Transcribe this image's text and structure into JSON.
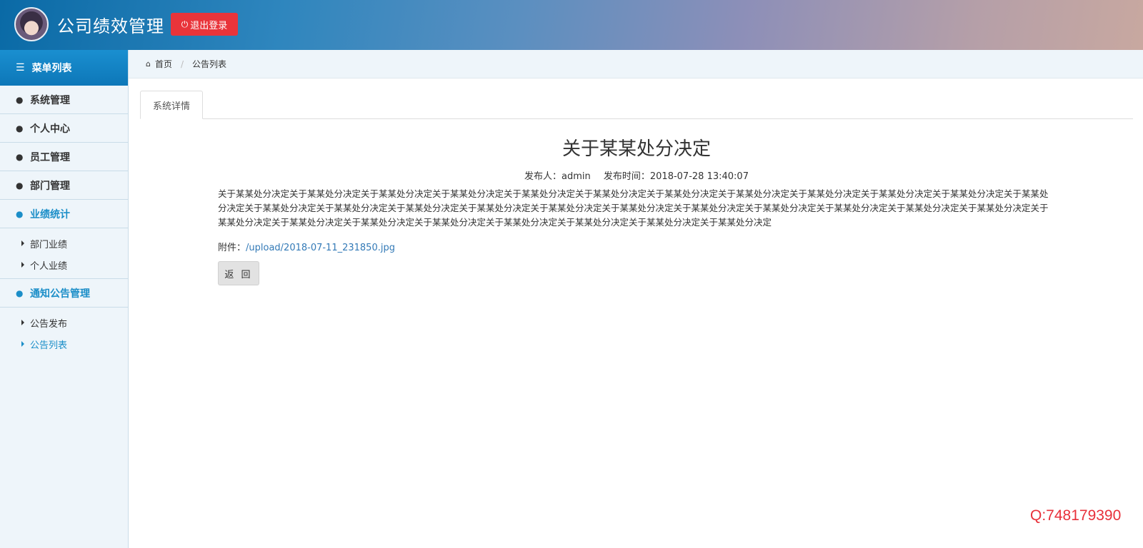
{
  "header": {
    "title": "公司绩效管理",
    "logout_label": "退出登录"
  },
  "sidebar": {
    "header_label": "菜单列表",
    "items": [
      {
        "label": "系统管理"
      },
      {
        "label": "个人中心"
      },
      {
        "label": "员工管理"
      },
      {
        "label": "部门管理"
      },
      {
        "label": "业绩统计",
        "active": true,
        "children": [
          "部门业绩",
          "个人业绩"
        ]
      },
      {
        "label": "通知公告管理",
        "active": true,
        "children": [
          "公告发布",
          "公告列表"
        ]
      }
    ],
    "active_child": "公告列表"
  },
  "breadcrumb": {
    "home": "首页",
    "current": "公告列表"
  },
  "tabs": [
    {
      "label": "系统详情"
    }
  ],
  "notice": {
    "title": "关于某某处分决定",
    "publisher_label": "发布人：admin",
    "time_label": "发布时间：2018-07-28 13:40:07",
    "body": "关于某某处分决定关于某某处分决定关于某某处分决定关于某某处分决定关于某某处分决定关于某某处分决定关于某某处分决定关于某某处分决定关于某某处分决定关于某某处分决定关于某某处分决定关于某某处分决定关于某某处分决定关于某某处分决定关于某某处分决定关于某某处分决定关于某某处分决定关于某某处分决定关于某某处分决定关于某某处分决定关于某某处分决定关于某某处分决定关于某某处分决定关于某某处分决定关于某某处分决定关于某某处分决定关于某某处分决定关于某某处分决定关于某某处分决定关于某某处分决定关于某某处分决定",
    "attachment_label": "附件：",
    "attachment_link": "/upload/2018-07-11_231850.jpg",
    "back_label": "返 回"
  },
  "watermark": "Q:748179390",
  "icons": {
    "menu": "list-icon",
    "user": "user-icon",
    "home": "home-icon",
    "power": "power-icon",
    "caret": "caret-right-icon"
  },
  "colors": {
    "accent": "#1b8ec8",
    "logout": "#e9343a",
    "watermark": "#e8303a"
  }
}
